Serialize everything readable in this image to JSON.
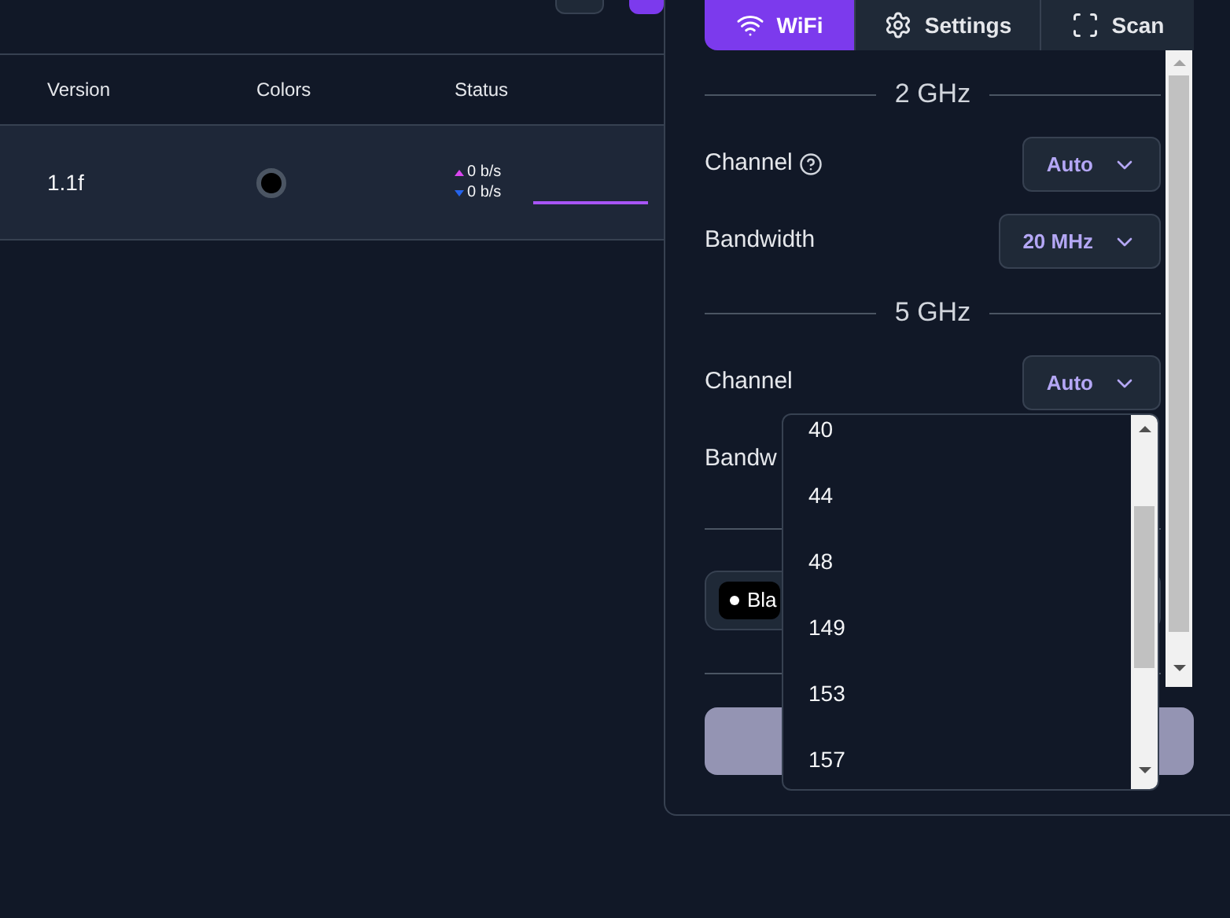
{
  "table": {
    "columns": [
      "Version",
      "Colors",
      "Status"
    ],
    "rows": [
      {
        "version": "1.1f",
        "color": "#000000",
        "upload": "0 b/s",
        "download": "0 b/s"
      }
    ]
  },
  "panel": {
    "tabs": [
      {
        "label": "WiFi",
        "kind": "wifi",
        "selected": true
      },
      {
        "label": "Settings",
        "kind": "settings",
        "selected": false
      },
      {
        "label": "Scan",
        "kind": "scan",
        "selected": false
      }
    ],
    "sections": [
      {
        "title": "2 GHz",
        "rows": [
          {
            "label": "Channel",
            "help": true,
            "value": "Auto"
          },
          {
            "label": "Bandwidth",
            "help": false,
            "value": "20 MHz"
          }
        ]
      },
      {
        "title": "5 GHz",
        "rows": [
          {
            "label": "Channel",
            "help": false,
            "value": "Auto"
          },
          {
            "label": "Bandw",
            "help": false
          }
        ]
      }
    ],
    "chip": {
      "label": "Bla"
    },
    "dropdown": {
      "options": [
        "40",
        "44",
        "48",
        "149",
        "153",
        "157"
      ]
    }
  }
}
